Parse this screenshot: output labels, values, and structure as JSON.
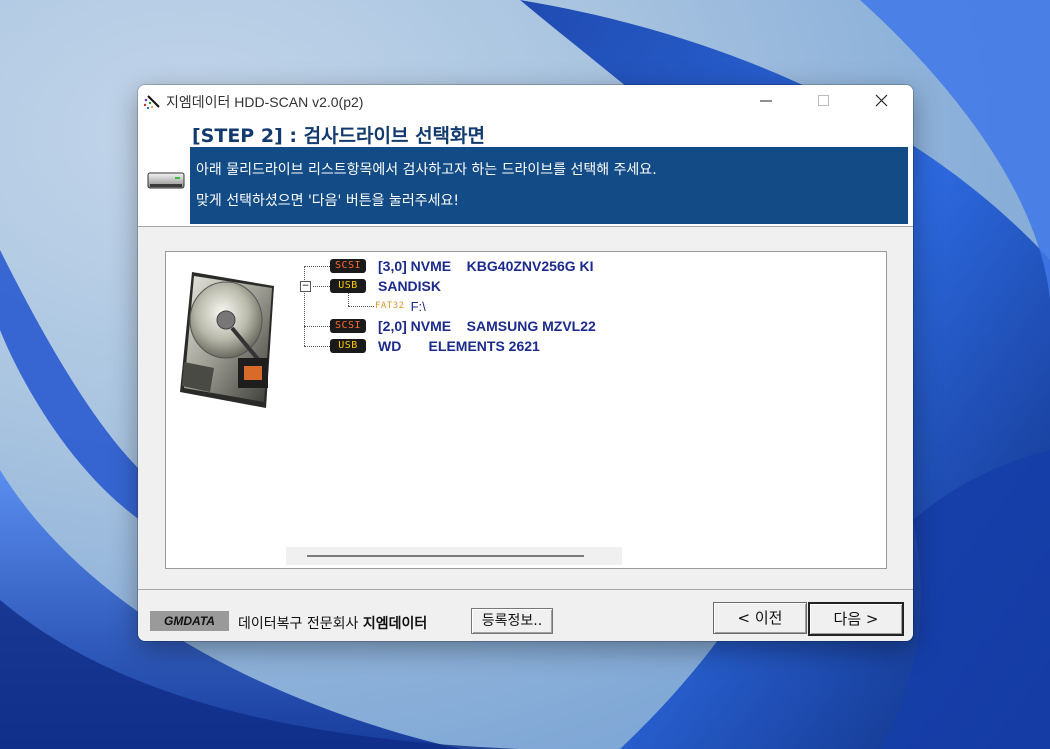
{
  "window": {
    "title": "지엠데이터 HDD-SCAN v2.0(p2)",
    "controls": {
      "minimize": "—",
      "maximize": "☐",
      "close": "✕"
    }
  },
  "header": {
    "step_title": "[STEP 2] : 검사드라이브 선택화면",
    "instruction_line1": "아래 물리드라이브 리스트항목에서 검사하고자 하는 드라이브를 선택해 주세요.",
    "instruction_line2": "맞게 선택하셨으면 '다음' 버튼을 눌러주세요!"
  },
  "drive_tree": [
    {
      "interface": "SCSI",
      "label": "[3,0] NVME    KBG40ZNV256G KI",
      "expanded": false
    },
    {
      "interface": "USB",
      "label": "SANDISK",
      "expanded": true,
      "children": [
        {
          "fs": "FAT32",
          "label": "F:\\"
        }
      ]
    },
    {
      "interface": "SCSI",
      "label": "[2,0] NVME    SAMSUNG MZVL22",
      "expanded": false
    },
    {
      "interface": "USB",
      "label": "WD       ELEMENTS 2621",
      "expanded": false
    }
  ],
  "footer": {
    "brand_logo": "GMDATA",
    "brand_desc": "데이터복구 전문회사",
    "brand_name": "지엠데이터",
    "register_button": "등록정보..",
    "prev_button": "< 이전",
    "next_button": "다음 >"
  },
  "icons": {
    "app": "magic-wand-icon",
    "header": "hard-drive-icon",
    "panel": "hdd-photo-icon",
    "expander": "minus-box-icon"
  },
  "colors": {
    "header_blue": "#124b86",
    "title_navy": "#123a6e",
    "drive_text": "#1b2a8c",
    "scsi_tag": "#ff6a2a",
    "usb_tag": "#ffcc00",
    "fat_tag": "#e0962a"
  }
}
